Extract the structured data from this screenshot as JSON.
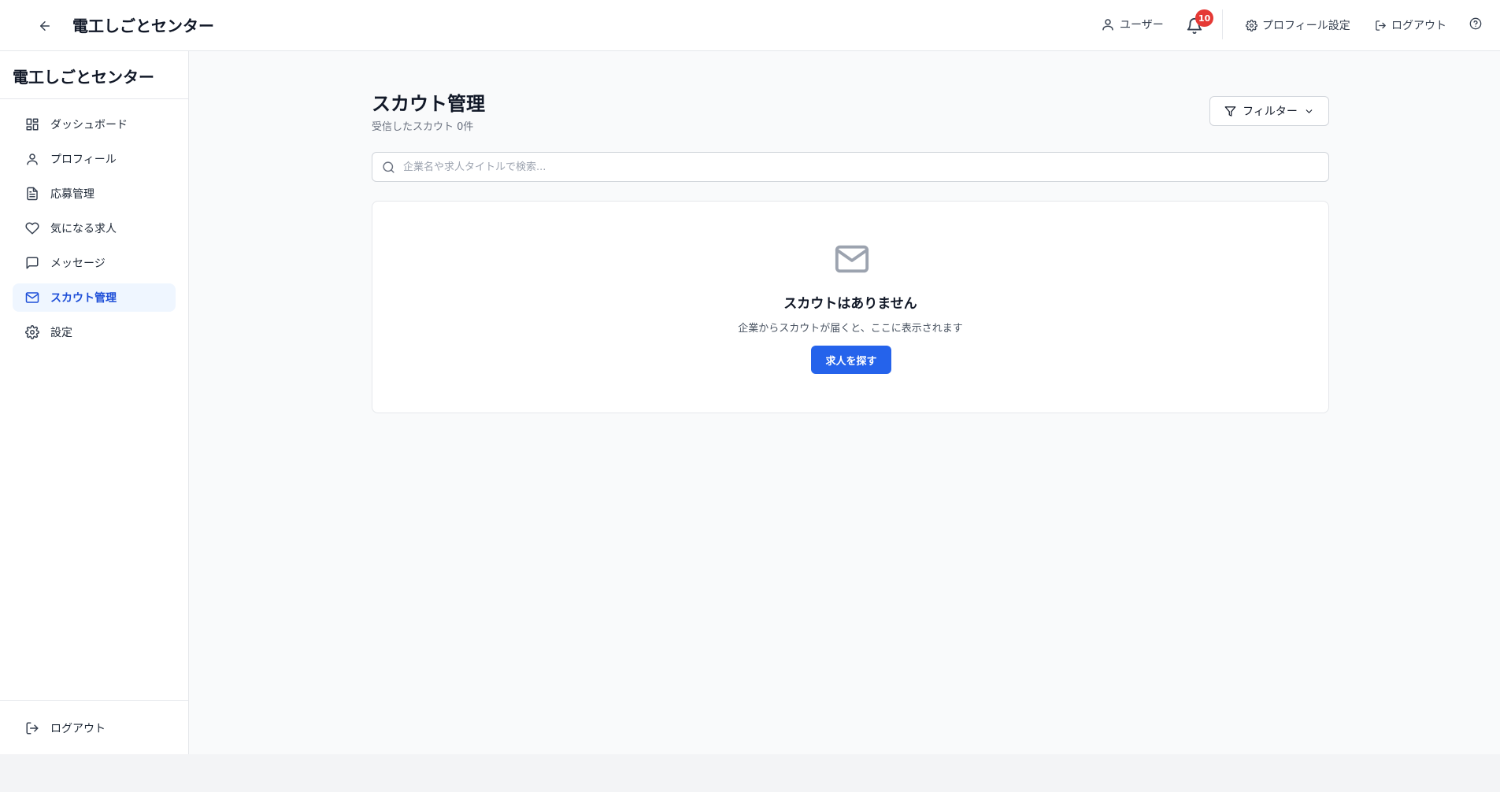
{
  "header": {
    "title": "電工しごとセンター",
    "user_label": "ユーザー",
    "notification_count": "10",
    "profile_settings_label": "プロフィール設定",
    "logout_label": "ログアウト"
  },
  "sidebar": {
    "title": "電工しごとセンター",
    "items": [
      {
        "label": "ダッシュボード",
        "icon": "dashboard-icon"
      },
      {
        "label": "プロフィール",
        "icon": "user-icon"
      },
      {
        "label": "応募管理",
        "icon": "document-icon"
      },
      {
        "label": "気になる求人",
        "icon": "heart-icon"
      },
      {
        "label": "メッセージ",
        "icon": "message-icon"
      },
      {
        "label": "スカウト管理",
        "icon": "mail-icon",
        "active": true
      },
      {
        "label": "設定",
        "icon": "gear-icon"
      }
    ],
    "logout_label": "ログアウト"
  },
  "main": {
    "title": "スカウト管理",
    "subtitle": "受信したスカウト 0件",
    "filter_label": "フィルター",
    "search_placeholder": "企業名や求人タイトルで検索...",
    "empty": {
      "title": "スカウトはありません",
      "description": "企業からスカウトが届くと、ここに表示されます",
      "button_label": "求人を探す"
    }
  },
  "colors": {
    "accent": "#2563eb",
    "active_nav_bg": "#eff6ff",
    "badge": "#e53935"
  }
}
